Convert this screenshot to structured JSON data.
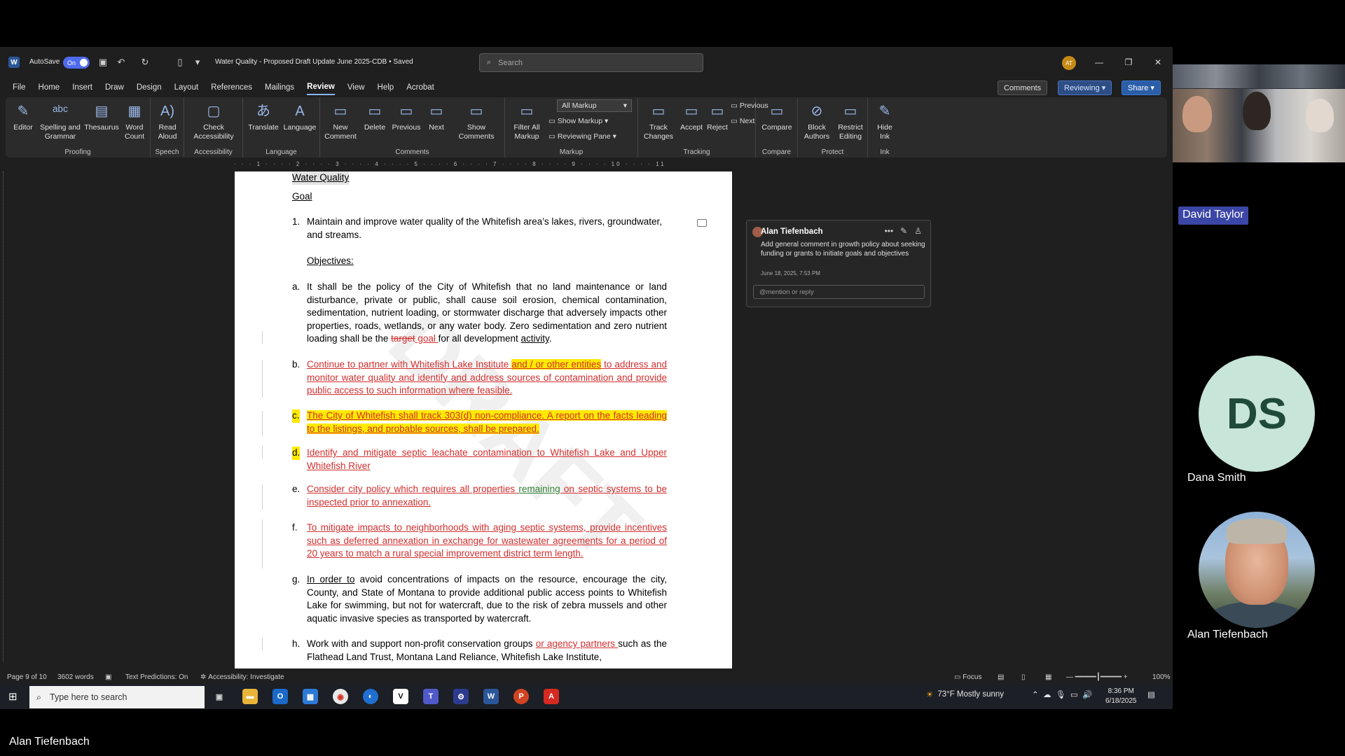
{
  "word": {
    "autosave_label": "AutoSave",
    "autosave_state": "On",
    "doc_title": "Water Quality - Proposed Draft Update June 2025-CDB • Saved",
    "search_placeholder": "Search",
    "user_initials": "AT",
    "tabs": [
      "File",
      "Home",
      "Insert",
      "Draw",
      "Design",
      "Layout",
      "References",
      "Mailings",
      "Review",
      "View",
      "Help",
      "Acrobat"
    ],
    "active_tab": "Review",
    "buttons": {
      "comments": "Comments",
      "reviewing": "Reviewing",
      "share": "Share"
    },
    "ribbon": {
      "editor": "Editor",
      "spelling": "Spelling and Grammar",
      "thesaurus": "Thesaurus",
      "word_count": "Word Count",
      "read_aloud": "Read Aloud",
      "check_access": "Check Accessibility",
      "translate": "Translate",
      "language": "Language",
      "new_comment": "New Comment",
      "delete": "Delete",
      "previous": "Previous",
      "next": "Next",
      "show_comments": "Show Comments",
      "filter_all_markup": "Filter All Markup",
      "markup_select": "All Markup",
      "show_markup": "Show Markup",
      "reviewing_pane": "Reviewing Pane",
      "track_changes": "Track Changes",
      "accept": "Accept",
      "reject": "Reject",
      "prev_change": "Previous",
      "next_change": "Next",
      "compare": "Compare",
      "block_authors": "Block Authors",
      "restrict_editing": "Restrict Editing",
      "hide_ink": "Hide Ink",
      "groups": {
        "proofing": "Proofing",
        "speech": "Speech",
        "accessibility": "Accessibility",
        "language": "Language",
        "comments": "Comments",
        "markup": "Markup",
        "tracking": "Tracking",
        "compare": "Compare",
        "protect": "Protect",
        "ink": "Ink"
      }
    },
    "document": {
      "title": "Water Quality",
      "goal_heading": "Goal",
      "goal_number": "1.",
      "goal_text": "Maintain and improve water quality of the Whitefish area’s lakes, rivers, groundwater, and streams.",
      "objectives_heading": "Objectives:",
      "watermark": "DRAFT",
      "items": {
        "a": {
          "marker": "a.",
          "text1": "It shall be the policy of the City of Whitefish that no land maintenance or land disturbance, private or public, shall cause soil erosion, chemical contamination, sedimentation, nutrient loading, or stormwater discharge that adversely impacts other properties, roads, wetlands, or any water body. Zero sedimentation and zero nutrient loading shall be the ",
          "deleted": "target",
          "inserted": " goal ",
          "text2": "for all development ",
          "text3": "activity",
          "text4": "."
        },
        "b": {
          "marker": "b.",
          "p1": "Continue",
          "p2": " to partner with Whitefish Lake Institute ",
          "p3": "and / or other entities",
          "p4": " to address and monitor water quality and identify and address sources of contamination and provide public access to such information where feasible."
        },
        "c": {
          "marker": "c.",
          "text": "The City of Whitefish shall track 303(d) non-compliance. A report on the facts leading to the listings, and probable sources, shall be prepared."
        },
        "d": {
          "marker": "d.",
          "p1": "Identify and mitigate septic leachate contamination to Whitefish Lake",
          "p2": " and Upper Whitefish River"
        },
        "e": {
          "marker": "e.",
          "p1": "Consider city policy which requires all properties ",
          "p2": "remaining",
          "p3": " on septic systems to be inspected prior to annexation."
        },
        "f": {
          "marker": "f.",
          "text": "To mitigate impacts to neighborhoods with aging septic systems, provide incentives such as deferred annexation in exchange for wastewater agreements for a period of 20 years to match a rural special improvement district term length."
        },
        "g": {
          "marker": "g.",
          "p1": "In order to",
          "p2": " avoid concentrations of impacts on the resource, encourage the city, County, and State of Montana to provide additional public access points to Whitefish Lake for swimming, but not for watercraft, due to the risk of zebra mussels and other aquatic invasive species as transported by watercraft."
        },
        "h": {
          "marker": "h.",
          "p1": "Work with and support non-profit conservation groups ",
          "p2": "or agency partners ",
          "p3": "such as the Flathead Land Trust, Montana Land Reliance, Whitefish Lake Institute,"
        }
      }
    },
    "comment": {
      "author": "Alan Tiefenbach",
      "body": "Add general comment in growth policy about seeking funding or grants to initiate goals and objectives",
      "date": "June 18, 2025, 7:53 PM",
      "reply_placeholder": "@mention or reply"
    },
    "status": {
      "page": "Page 9 of 10",
      "words": "3602 words",
      "predictions": "Text Predictions: On",
      "accessibility": "Accessibility: Investigate",
      "focus": "Focus",
      "zoom": "100%"
    }
  },
  "taskbar": {
    "search_placeholder": "Type here to search",
    "weather": "73°F  Mostly sunny",
    "time": "8:36 PM",
    "date": "6/18/2025"
  },
  "meeting": {
    "speaker_tag": "David Taylor",
    "participants": [
      {
        "name": "Dana Smith",
        "initials": "DS"
      },
      {
        "name": "Alan Tiefenbach"
      }
    ],
    "bottom_name": "Alan Tiefenbach",
    "colors": {
      "ds_avatar_bg": "#c7e5d8",
      "name_tag_bg": "#3c46a6"
    }
  }
}
